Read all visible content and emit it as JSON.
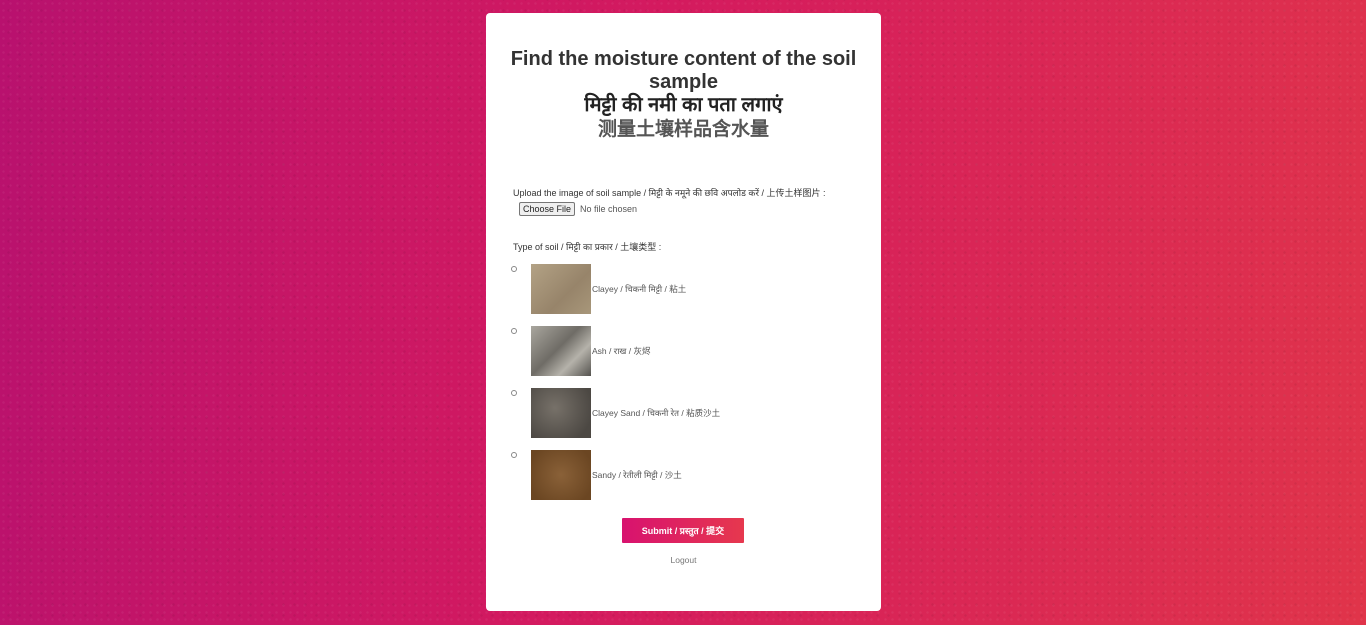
{
  "title": {
    "en": "Find the moisture content of the soil sample",
    "hi": "मिट्टी की नमी का पता लगाएं",
    "zh": "测量土壤样品含水量"
  },
  "upload": {
    "label": "Upload the image of soil sample / मिट्टी के नमूने की छवि अपलोड करें / 上传土样图片 :",
    "button_label": "Choose File",
    "status": "No file chosen"
  },
  "soil_type": {
    "label": "Type of soil / मिट्टी का प्रकार / 土壤类型 :",
    "options": [
      {
        "label": "Clayey / चिकनी मिट्टी / 粘土",
        "color": "#a08e70"
      },
      {
        "label": "Ash / राख / 灰烬",
        "color": "#8c8880"
      },
      {
        "label": "Clayey Sand / चिकनी रेत / 粘质沙土",
        "color": "#5e5953"
      },
      {
        "label": "Sandy / रेतीली मिट्टी / 沙土",
        "color": "#7a5330"
      }
    ]
  },
  "submit_label": "Submit / प्रस्तुत / 提交",
  "logout_label": "Logout"
}
